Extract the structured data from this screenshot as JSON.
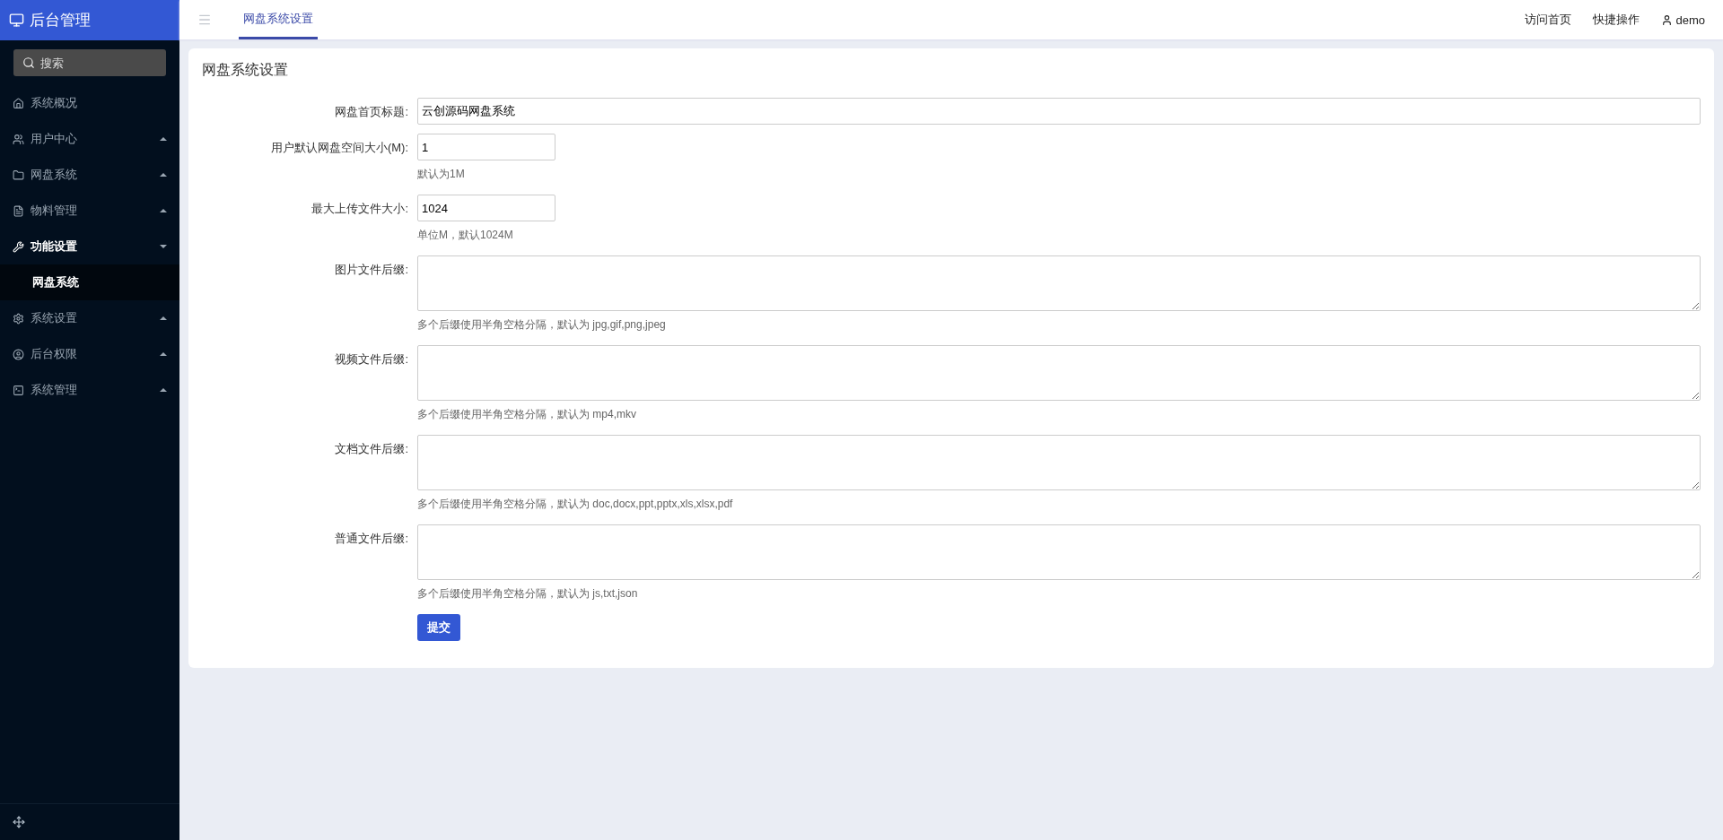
{
  "brand": {
    "title": "后台管理"
  },
  "sidebar": {
    "search": {
      "placeholder": "搜索"
    },
    "items": [
      {
        "label": "系统概况",
        "kind": "link"
      },
      {
        "label": "用户中心",
        "kind": "group",
        "expanded": false
      },
      {
        "label": "网盘系统",
        "kind": "group",
        "expanded": false
      },
      {
        "label": "物料管理",
        "kind": "group",
        "expanded": false
      },
      {
        "label": "功能设置",
        "kind": "group",
        "expanded": true,
        "children": [
          {
            "label": "网盘系统",
            "selected": true
          }
        ]
      },
      {
        "label": "系统设置",
        "kind": "group",
        "expanded": false
      },
      {
        "label": "后台权限",
        "kind": "group",
        "expanded": false
      },
      {
        "label": "系统管理",
        "kind": "group",
        "expanded": false
      }
    ]
  },
  "tabs": [
    {
      "label": "网盘系统设置",
      "selected": true
    }
  ],
  "header_links": [
    {
      "label": "访问首页",
      "kind": "link"
    },
    {
      "label": "快捷操作",
      "kind": "link"
    },
    {
      "label": "demo",
      "kind": "user"
    }
  ],
  "card": {
    "title": "网盘系统设置",
    "fields": [
      {
        "label": "网盘首页标题:",
        "kind": "wide",
        "value": "云创源码网盘系统"
      },
      {
        "label": "用户默认网盘空间大小(M):",
        "kind": "short",
        "value": "1",
        "hint": "默认为1M"
      },
      {
        "label": "最大上传文件大小:",
        "kind": "short",
        "value": "1024",
        "hint": "单位M，默认1024M"
      },
      {
        "label": "图片文件后缀:",
        "kind": "textarea",
        "hint": "多个后缀使用半角空格分隔，默认为 jpg,gif,png,jpeg"
      },
      {
        "label": "视频文件后缀:",
        "kind": "textarea",
        "hint": "多个后缀使用半角空格分隔，默认为 mp4,mkv"
      },
      {
        "label": "文档文件后缀:",
        "kind": "textarea",
        "hint": "多个后缀使用半角空格分隔，默认为 doc,docx,ppt,pptx,xls,xlsx,pdf"
      },
      {
        "label": "普通文件后缀:",
        "kind": "textarea",
        "hint": "多个后缀使用半角空格分隔，默认为 js,txt,json"
      }
    ],
    "submit": "提交"
  }
}
